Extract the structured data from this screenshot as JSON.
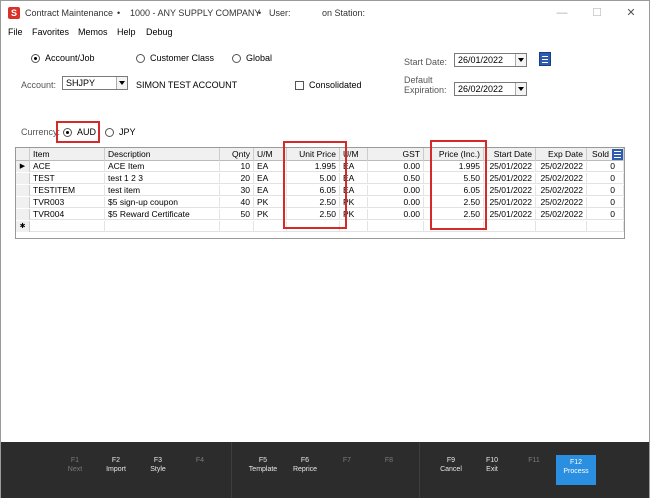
{
  "titlebar": {
    "app_icon_letter": "S",
    "title": "Contract Maintenance",
    "bullet1": "•",
    "company": "1000 - ANY SUPPLY COMPANY",
    "bullet2": "•",
    "user_label": "User:",
    "station_label": "on Station:",
    "minimize": "—",
    "maximize": "☐",
    "close": "✕"
  },
  "menu": [
    "File",
    "Favorites",
    "Memos",
    "Help",
    "Debug"
  ],
  "scope": {
    "options": [
      "Account/Job",
      "Customer Class",
      "Global"
    ],
    "selected": "Account/Job"
  },
  "account": {
    "label": "Account:",
    "value": "SHJPY",
    "name": "SIMON TEST ACCOUNT"
  },
  "consolidated": {
    "label": "Consolidated",
    "checked": false
  },
  "start_date": {
    "label": "Start Date:",
    "value": "26/01/2022"
  },
  "default_expiration": {
    "label_line1": "Default",
    "label_line2": "Expiration:",
    "value": "26/02/2022"
  },
  "currency": {
    "label": "Currency:",
    "options": [
      "AUD",
      "JPY"
    ],
    "selected": "AUD"
  },
  "grid": {
    "columns": [
      "Item",
      "Description",
      "Qnty",
      "U/M",
      "Unit Price",
      "U/M",
      "GST",
      "Price (Inc.)",
      "Start Date",
      "Exp Date",
      "Sold"
    ],
    "rows": [
      [
        "ACE",
        "ACE Item",
        "10",
        "EA",
        "1.995",
        "EA",
        "0.00",
        "1.995",
        "25/01/2022",
        "25/02/2022",
        "0"
      ],
      [
        "TEST",
        "test 1 2 3",
        "20",
        "EA",
        "5.00",
        "EA",
        "0.50",
        "5.50",
        "25/01/2022",
        "25/02/2022",
        "0"
      ],
      [
        "TESTITEM",
        "test item",
        "30",
        "EA",
        "6.05",
        "EA",
        "0.00",
        "6.05",
        "25/01/2022",
        "25/02/2022",
        "0"
      ],
      [
        "TVR003",
        "$5 sign-up coupon",
        "40",
        "PK",
        "2.50",
        "PK",
        "0.00",
        "2.50",
        "25/01/2022",
        "25/02/2022",
        "0"
      ],
      [
        "TVR004",
        "$5 Reward Certificate",
        "50",
        "PK",
        "2.50",
        "PK",
        "0.00",
        "2.50",
        "25/01/2022",
        "25/02/2022",
        "0"
      ]
    ],
    "current_row_marker": "▶",
    "new_row_marker": "✱"
  },
  "fkeys": [
    {
      "key": "F1",
      "label": "Next",
      "enabled": false
    },
    {
      "key": "F2",
      "label": "Import",
      "enabled": true
    },
    {
      "key": "F3",
      "label": "Style",
      "enabled": true
    },
    {
      "key": "F4",
      "label": "",
      "enabled": false
    },
    {
      "key": "F5",
      "label": "Template",
      "enabled": true
    },
    {
      "key": "F6",
      "label": "Reprice",
      "enabled": true
    },
    {
      "key": "F7",
      "label": "",
      "enabled": false
    },
    {
      "key": "F8",
      "label": "",
      "enabled": false
    },
    {
      "key": "F9",
      "label": "Cancel",
      "enabled": true
    },
    {
      "key": "F10",
      "label": "Exit",
      "enabled": true
    },
    {
      "key": "F11",
      "label": "",
      "enabled": false
    },
    {
      "key": "F12",
      "label": "Process",
      "enabled": true,
      "active": true
    }
  ],
  "colors": {
    "accent_blue": "#2a8fe0",
    "highlight_red": "#d42a2a",
    "fkey_bar": "#2c2c2c"
  }
}
